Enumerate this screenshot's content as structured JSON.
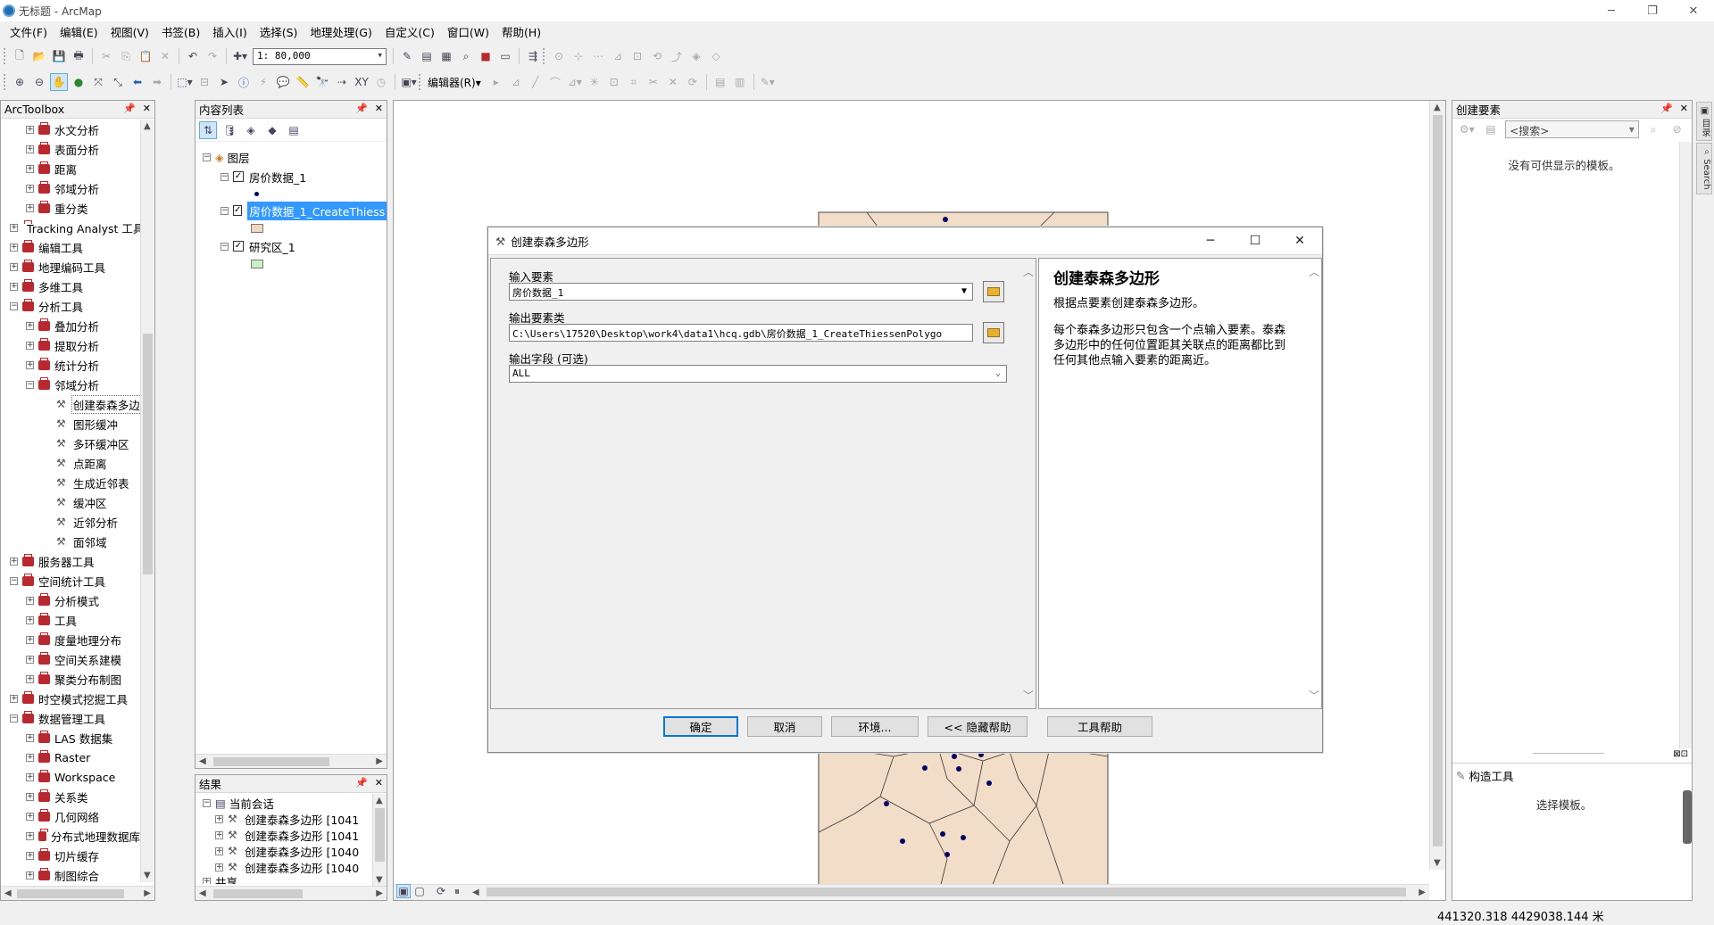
{
  "window": {
    "title": "无标题 - ArcMap",
    "controls": [
      "─",
      "❐",
      "✕"
    ]
  },
  "menu": [
    "文件(F)",
    "编辑(E)",
    "视图(V)",
    "书签(B)",
    "插入(I)",
    "选择(S)",
    "地理处理(G)",
    "自定义(C)",
    "窗口(W)",
    "帮助(H)"
  ],
  "toolbar": {
    "scale": "1: 80,000",
    "editor": "编辑器(R)▾"
  },
  "toolbox": {
    "title": "ArcToolbox",
    "items": [
      {
        "label": "水文分析",
        "level": 1,
        "exp": "+"
      },
      {
        "label": "表面分析",
        "level": 1,
        "exp": "+"
      },
      {
        "label": "距离",
        "level": 1,
        "exp": "+"
      },
      {
        "label": "邻域分析",
        "level": 1,
        "exp": "+"
      },
      {
        "label": "重分类",
        "level": 1,
        "exp": "+"
      },
      {
        "label": "Tracking Analyst 工具",
        "level": 0,
        "exp": "+"
      },
      {
        "label": "编辑工具",
        "level": 0,
        "exp": "+"
      },
      {
        "label": "地理编码工具",
        "level": 0,
        "exp": "+"
      },
      {
        "label": "多维工具",
        "level": 0,
        "exp": "+"
      },
      {
        "label": "分析工具",
        "level": 0,
        "exp": "−"
      },
      {
        "label": "叠加分析",
        "level": 1,
        "exp": "+"
      },
      {
        "label": "提取分析",
        "level": 1,
        "exp": "+"
      },
      {
        "label": "统计分析",
        "level": 1,
        "exp": "+"
      },
      {
        "label": "邻域分析",
        "level": 1,
        "exp": "−"
      },
      {
        "label": "创建泰森多边形",
        "level": 2,
        "tool": true,
        "selected": true
      },
      {
        "label": "图形缓冲",
        "level": 2,
        "tool": true
      },
      {
        "label": "多环缓冲区",
        "level": 2,
        "tool": true
      },
      {
        "label": "点距离",
        "level": 2,
        "tool": true
      },
      {
        "label": "生成近邻表",
        "level": 2,
        "tool": true
      },
      {
        "label": "缓冲区",
        "level": 2,
        "tool": true
      },
      {
        "label": "近邻分析",
        "level": 2,
        "tool": true
      },
      {
        "label": "面邻域",
        "level": 2,
        "tool": true
      },
      {
        "label": "服务器工具",
        "level": 0,
        "exp": "+"
      },
      {
        "label": "空间统计工具",
        "level": 0,
        "exp": "−"
      },
      {
        "label": "分析模式",
        "level": 1,
        "exp": "+"
      },
      {
        "label": "工具",
        "level": 1,
        "exp": "+"
      },
      {
        "label": "度量地理分布",
        "level": 1,
        "exp": "+"
      },
      {
        "label": "空间关系建模",
        "level": 1,
        "exp": "+"
      },
      {
        "label": "聚类分布制图",
        "level": 1,
        "exp": "+"
      },
      {
        "label": "时空模式挖掘工具",
        "level": 0,
        "exp": "+"
      },
      {
        "label": "数据管理工具",
        "level": 0,
        "exp": "−"
      },
      {
        "label": "LAS 数据集",
        "level": 1,
        "exp": "+"
      },
      {
        "label": "Raster",
        "level": 1,
        "exp": "+"
      },
      {
        "label": "Workspace",
        "level": 1,
        "exp": "+"
      },
      {
        "label": "关系类",
        "level": 1,
        "exp": "+"
      },
      {
        "label": "几何网络",
        "level": 1,
        "exp": "+"
      },
      {
        "label": "分布式地理数据库",
        "level": 1,
        "exp": "+"
      },
      {
        "label": "切片缓存",
        "level": 1,
        "exp": "+"
      },
      {
        "label": "制图综合",
        "level": 1,
        "exp": "+"
      }
    ]
  },
  "contents": {
    "title": "内容列表",
    "root": "图层",
    "layers": [
      {
        "name": "房价数据_1",
        "checked": "✓",
        "symbol": "point"
      },
      {
        "name": "房价数据_1_CreateThiess",
        "checked": "✓",
        "symbol": "#f0d8c0",
        "selected": true
      },
      {
        "name": "研究区_1",
        "checked": "✓",
        "symbol": "#c8f0c8"
      }
    ]
  },
  "results": {
    "title": "结果",
    "session": "当前会话",
    "items": [
      "创建泰森多边形 [1041",
      "创建泰森多边形 [1041",
      "创建泰森多边形 [1040",
      "创建泰森多边形 [1040"
    ],
    "shared": "共享"
  },
  "dialog": {
    "title": "创建泰森多边形",
    "input_label": "输入要素",
    "input_value": "房价数据_1",
    "output_label": "输出要素类",
    "output_value": "C:\\Users\\17520\\Desktop\\work4\\data1\\hcq.gdb\\房价数据_1_CreateThiessenPolygo",
    "fields_label": "输出字段 (可选)",
    "fields_value": "ALL",
    "help_title": "创建泰森多边形",
    "help_p1": "根据点要素创建泰森多边形。",
    "help_p2": "每个泰森多边形只包含一个点输入要素。泰森多边形中的任何位置距其关联点的距离都比到任何其他点输入要素的距离近。",
    "buttons": {
      "ok": "确定",
      "cancel": "取消",
      "env": "环境...",
      "hide": "<< 隐藏帮助",
      "toolhelp": "工具帮助"
    }
  },
  "create_features": {
    "title": "创建要素",
    "search": "<搜索>",
    "empty": "没有可供显示的模板。",
    "construct_title": "构造工具",
    "construct_empty": "选择模板。"
  },
  "side_tabs": [
    "目录",
    "Search"
  ],
  "status": {
    "coords": "441320.318  4429038.144 米"
  },
  "colors": {
    "polygon_fill": "#f2ddc8",
    "selection": "#3399ff",
    "point": "#000066",
    "toolbox_icon": "#b8292f"
  }
}
